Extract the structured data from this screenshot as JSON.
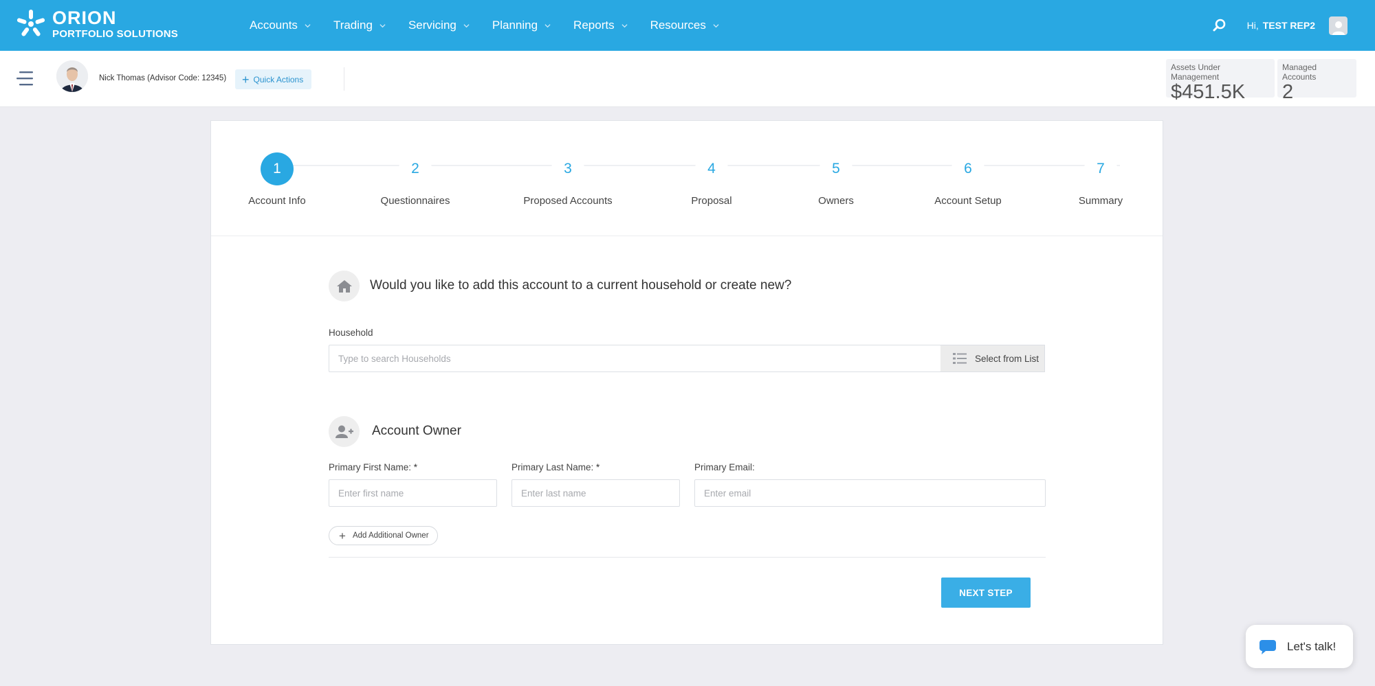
{
  "brand": {
    "name": "ORION",
    "subtitle": "PORTFOLIO SOLUTIONS"
  },
  "nav": {
    "items": [
      {
        "label": "Accounts"
      },
      {
        "label": "Trading"
      },
      {
        "label": "Servicing"
      },
      {
        "label": "Planning"
      },
      {
        "label": "Reports"
      },
      {
        "label": "Resources"
      }
    ]
  },
  "user": {
    "greeting": "Hi,",
    "name": "TEST REP2"
  },
  "advisor": {
    "name": "Nick Thomas (Advisor Code: 12345)"
  },
  "quick_actions": {
    "label": "Quick Actions"
  },
  "stats": {
    "aum": {
      "label": "Assets Under Management",
      "value": "$451.5K"
    },
    "managed": {
      "label": "Managed Accounts",
      "value": "2"
    }
  },
  "stepper": {
    "active_step": 1,
    "steps": [
      {
        "num": "1",
        "label": "Account Info"
      },
      {
        "num": "2",
        "label": "Questionnaires"
      },
      {
        "num": "3",
        "label": "Proposed Accounts"
      },
      {
        "num": "4",
        "label": "Proposal"
      },
      {
        "num": "5",
        "label": "Owners"
      },
      {
        "num": "6",
        "label": "Account Setup"
      },
      {
        "num": "7",
        "label": "Summary"
      }
    ]
  },
  "household": {
    "question": "Would you like to add this account to a current household or create new?",
    "label": "Household",
    "placeholder": "Type to search Households",
    "value": "",
    "select_button": "Select from List"
  },
  "owner": {
    "title": "Account Owner",
    "first_name": {
      "label": "Primary First Name:",
      "required": "*",
      "placeholder": "Enter first name",
      "value": ""
    },
    "last_name": {
      "label": "Primary Last Name:",
      "required": "*",
      "placeholder": "Enter last name",
      "value": ""
    },
    "email": {
      "label": "Primary Email:",
      "placeholder": "Enter email",
      "value": ""
    },
    "add_owner": "Add Additional Owner"
  },
  "actions": {
    "next": "NEXT STEP"
  },
  "chat": {
    "label": "Let's talk!"
  },
  "colors": {
    "brand": "#29a8e2",
    "button": "#3aaee6",
    "background": "#ededf2"
  }
}
